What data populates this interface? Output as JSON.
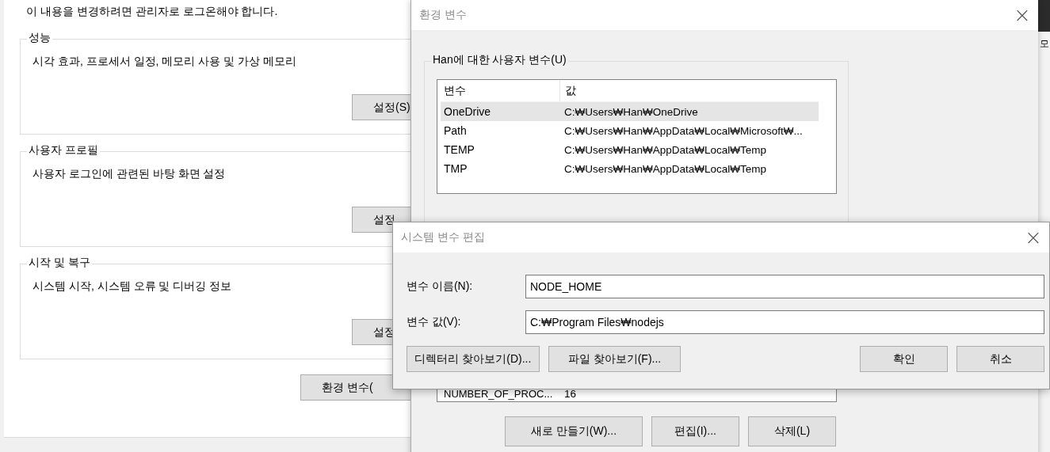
{
  "background_window": {
    "notice": "이 내용을 변경하려면 관리자로 로그온해야 합니다.",
    "groups": [
      {
        "title": "성능",
        "description": "시각 효과, 프로세서 일정, 메모리 사용 및 가상 메모리",
        "button": "설정(S)"
      },
      {
        "title": "사용자 프로필",
        "description": "사용자 로그인에 관련된 바탕 화면 설정",
        "button": "설정"
      },
      {
        "title": "시작 및 복구",
        "description": "시스템 시작, 시스템 오류 및 디버깅 정보",
        "button": "설정"
      }
    ],
    "button": "환경 변수("
  },
  "desktop": {
    "text": "모"
  },
  "environment_window": {
    "title": "환경 변수",
    "close": "×",
    "user_variables": {
      "title": "Han에 대한 사용자 변수(U)",
      "columns": [
        "변수",
        "값"
      ],
      "rows": [
        {
          "name": "OneDrive",
          "value": "C:₩Users₩Han₩OneDrive",
          "selected": true
        },
        {
          "name": "Path",
          "value": "C:₩Users₩Han₩AppData₩Local₩Microsoft₩...",
          "selected": false
        },
        {
          "name": "TEMP",
          "value": "C:₩Users₩Han₩AppData₩Local₩Temp",
          "selected": false
        },
        {
          "name": "TMP",
          "value": "C:₩Users₩Han₩AppData₩Local₩Temp",
          "selected": false
        }
      ]
    },
    "system_variables": {
      "rows": [
        {
          "name": "NUMBER_OF_PROC...",
          "value": "16"
        }
      ],
      "buttons": [
        "새로 만들기(W)...",
        "편집(I)...",
        "삭제(L)"
      ]
    }
  },
  "edit_dialog": {
    "title": "시스템 변수 편집",
    "close": "×",
    "fields": [
      {
        "label": "변수 이름(N):",
        "value": "NODE_HOME"
      },
      {
        "label": "변수 값(V):",
        "value": "C:₩Program Files₩nodejs"
      }
    ],
    "buttons": [
      "디렉터리 찾아보기(D)...",
      "파일 찾아보기(F)...",
      "확인",
      "취소"
    ]
  }
}
